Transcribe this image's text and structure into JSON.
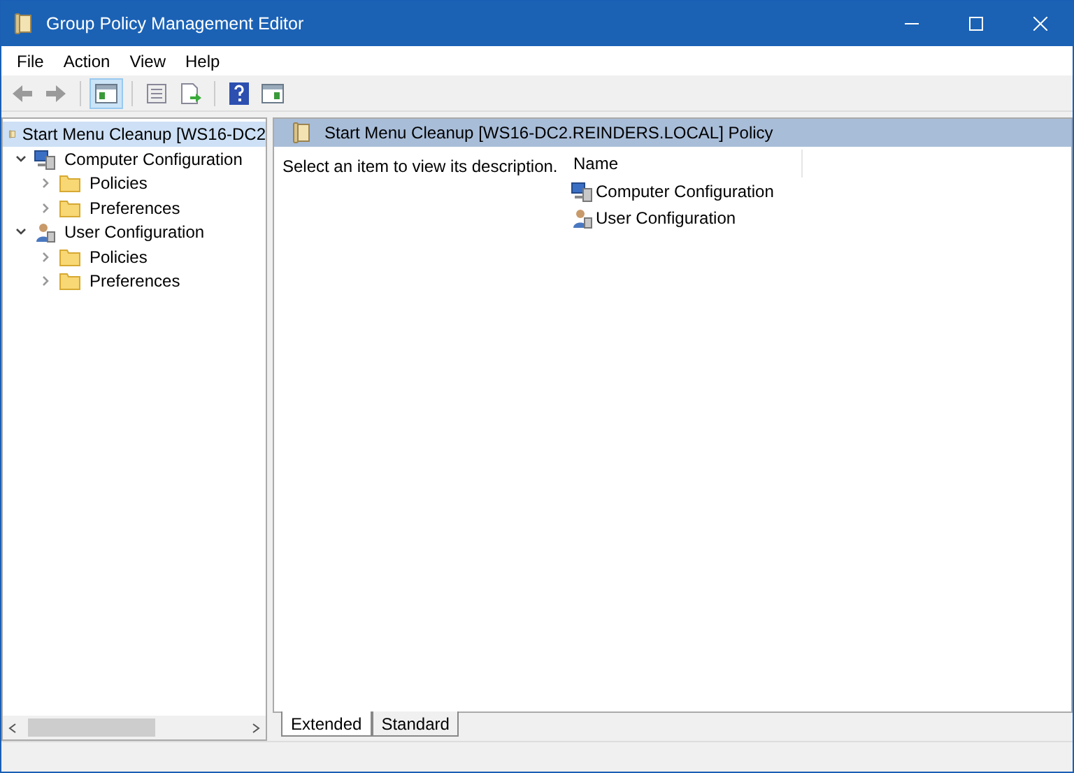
{
  "window": {
    "title": "Group Policy Management Editor"
  },
  "menu": [
    "File",
    "Action",
    "View",
    "Help"
  ],
  "tree": {
    "label": "Start Menu Cleanup [WS16-DC2",
    "children": [
      {
        "label": "Computer Configuration",
        "kind": "computer",
        "expanded": true,
        "children": [
          {
            "label": "Policies",
            "kind": "folder",
            "expanded": false
          },
          {
            "label": "Preferences",
            "kind": "folder",
            "expanded": false
          }
        ]
      },
      {
        "label": "User Configuration",
        "kind": "user",
        "expanded": true,
        "children": [
          {
            "label": "Policies",
            "kind": "folder",
            "expanded": false
          },
          {
            "label": "Preferences",
            "kind": "folder",
            "expanded": false
          }
        ]
      }
    ]
  },
  "content": {
    "title": "Start Menu Cleanup [WS16-DC2.REINDERS.LOCAL] Policy",
    "description": "Select an item to view its description.",
    "column": "Name",
    "items": [
      {
        "label": "Computer Configuration",
        "kind": "computer"
      },
      {
        "label": "User Configuration",
        "kind": "user"
      }
    ]
  },
  "tabs": [
    {
      "label": "Extended",
      "selected": true
    },
    {
      "label": "Standard",
      "selected": false
    }
  ]
}
